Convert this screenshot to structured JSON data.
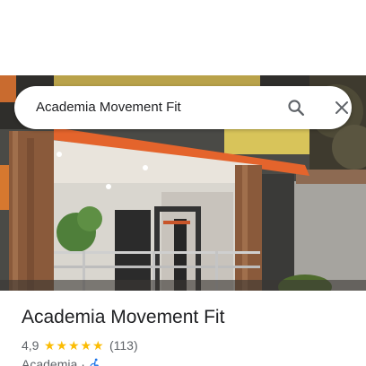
{
  "search": {
    "query": "Academia Movement Fit",
    "search_icon": "search-icon",
    "close_icon": "close-icon"
  },
  "place": {
    "name": "Academia Movement Fit",
    "rating": "4,9",
    "stars": 5,
    "reviews": "(113)",
    "category": "Academia",
    "separator": "·",
    "accessibility_icon": "wheelchair-accessible-icon"
  },
  "colors": {
    "star": "#fbbc04",
    "accessibility": "#1a73e8",
    "text_primary": "#202124",
    "text_secondary": "#5f6368"
  }
}
